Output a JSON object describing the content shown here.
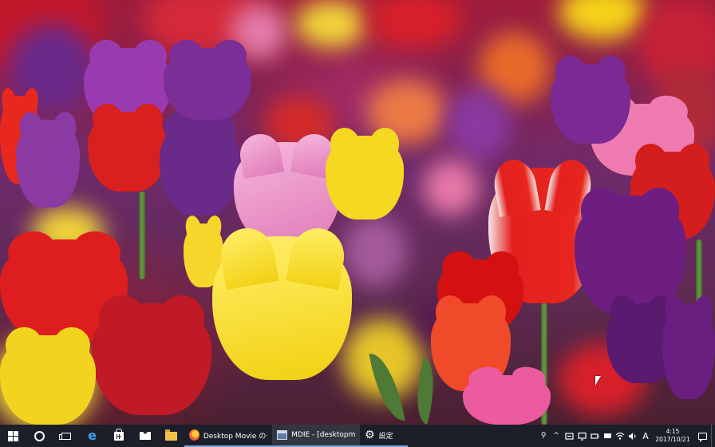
{
  "wallpaper": {
    "subject": "tulip field",
    "accent_colors": [
      "#d81f2a",
      "#7b2c8e",
      "#f5d21f",
      "#ee6ba6"
    ]
  },
  "taskbar": {
    "start_icon": "windows-logo-icon",
    "pinned": [
      {
        "icon": "cortana-icon"
      },
      {
        "icon": "task-view-icon"
      },
      {
        "icon": "edge-icon",
        "glyph": "e"
      },
      {
        "icon": "store-icon"
      },
      {
        "icon": "mail-icon"
      },
      {
        "icon": "folder-icon"
      }
    ],
    "apps": [
      {
        "icon": "firefox-icon",
        "label": "Desktop Movie のダ",
        "active": false
      },
      {
        "icon": "mdie-icon",
        "label": "MDIE - [desktopmo",
        "active": true
      },
      {
        "icon": "gear-icon",
        "label": "設定",
        "active": false
      }
    ],
    "tray": {
      "people_glyph": "⚲",
      "chevron_glyph": "^",
      "icons": [
        "sync-icon",
        "screen-icon",
        "battery-icon",
        "display-icon",
        "wifi-icon",
        "volume-icon"
      ],
      "ime_label": "A",
      "time": "4:15",
      "date": "2017/10/21"
    }
  }
}
